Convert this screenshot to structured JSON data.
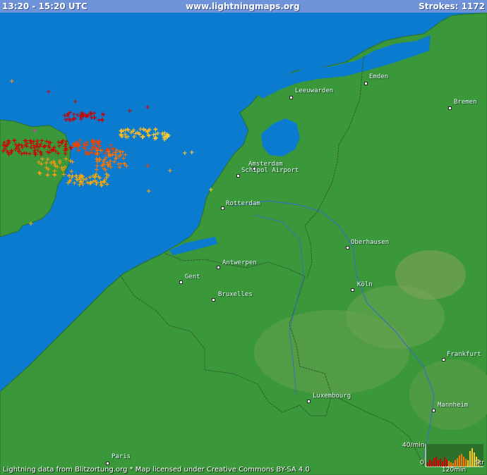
{
  "header": {
    "time_range": "13:20 - 15:20 UTC",
    "site": "www.lightningmaps.org",
    "strokes": "Strokes: 1172"
  },
  "cities": [
    {
      "name": "Emden"
    },
    {
      "name": "Leeuwarden"
    },
    {
      "name": "Bremen"
    },
    {
      "name": "Amsterdam"
    },
    {
      "name": "Schipol Airport"
    },
    {
      "name": "Rotterdam"
    },
    {
      "name": "Oberhausen"
    },
    {
      "name": "Antwerpen"
    },
    {
      "name": "Gent"
    },
    {
      "name": "Bruxelles"
    },
    {
      "name": "Köln"
    },
    {
      "name": "Frankfurt"
    },
    {
      "name": "Luxembourg"
    },
    {
      "name": "Mannheim"
    },
    {
      "name": "Paris"
    }
  ],
  "histogram": {
    "max_label": "40/min",
    "zero_label": "0",
    "duration_label": "120min",
    "suffix_label": "Str"
  },
  "footer": "Lightning data from Blitzortung.org  *  Map licensed under Creative Commons BY-SA 4.0",
  "colors": {
    "sea": "#0b7bd0",
    "land": "#3a973a",
    "header_bar": "#6e93d9",
    "stroke_recent": "#ffcc22",
    "stroke_old": "#cc0000"
  }
}
